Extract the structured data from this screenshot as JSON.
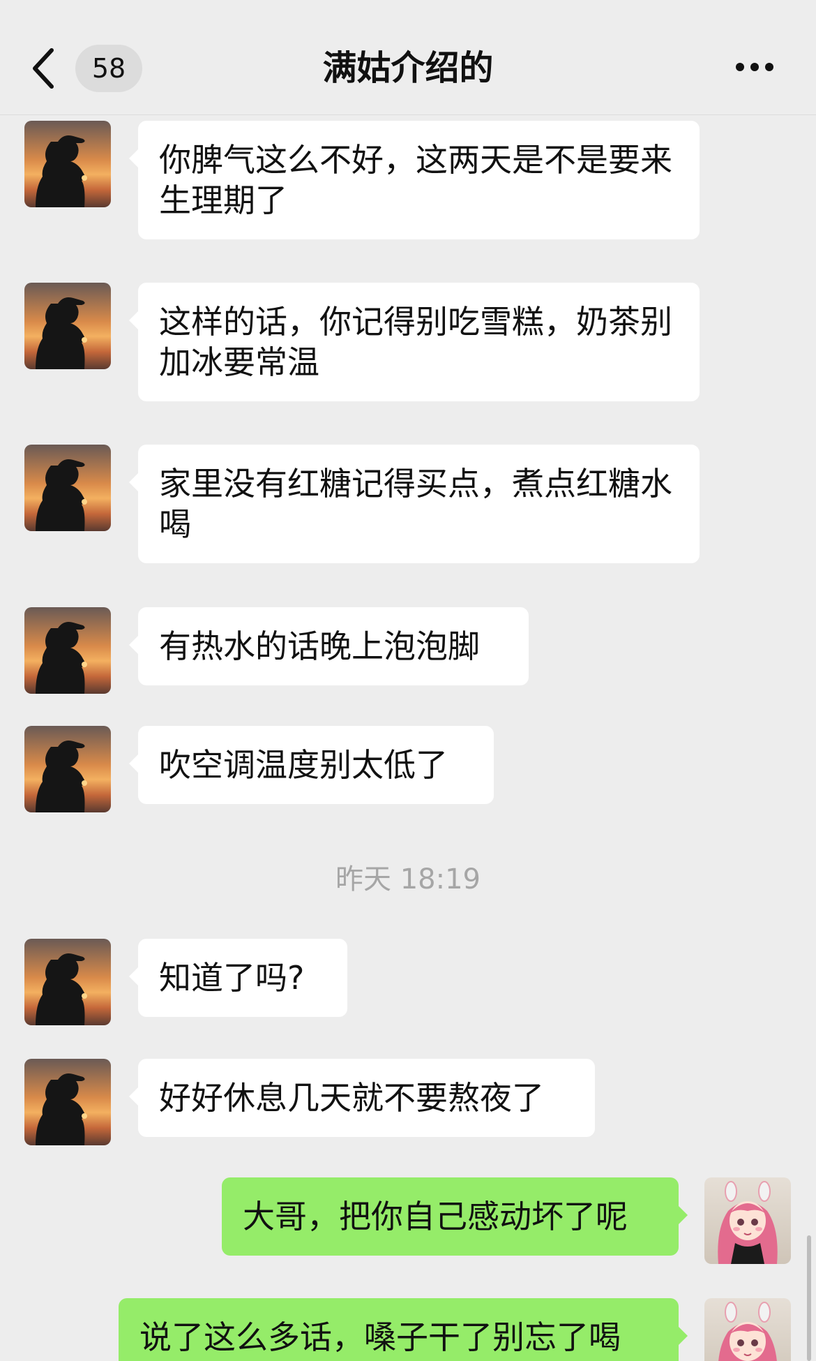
{
  "nav": {
    "unread_count": "58",
    "title": "满姑介绍的"
  },
  "messages": [
    {
      "side": "left",
      "text": "你脾气这么不好，这两天是不是要来生理期了"
    },
    {
      "side": "left",
      "text": "这样的话，你记得别吃雪糕，奶茶别加冰要常温"
    },
    {
      "side": "left",
      "text": "家里没有红糖记得买点，煮点红糖水喝"
    },
    {
      "side": "left",
      "text": "有热水的话晚上泡泡脚"
    },
    {
      "side": "left",
      "text": "吹空调温度别太低了"
    },
    {
      "side": "left",
      "text": "知道了吗?"
    },
    {
      "side": "left",
      "text": "好好休息几天就不要熬夜了"
    },
    {
      "side": "right",
      "text": "大哥，把你自己感动坏了呢"
    },
    {
      "side": "right",
      "text": "说了这么多话，嗓子干了别忘了喝"
    }
  ],
  "timestamp": "昨天 18:19",
  "icons": {
    "back": "chevron-left-icon",
    "more": "more-dots-icon"
  },
  "colors": {
    "background": "#ededed",
    "incoming_bubble": "#ffffff",
    "outgoing_bubble": "#95ec69",
    "timestamp_text": "#a6a6a6"
  }
}
